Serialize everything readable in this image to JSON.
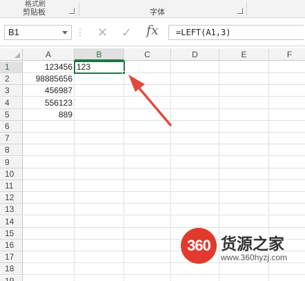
{
  "ribbon": {
    "clipboard_label": "剪贴板",
    "font_label": "字体",
    "top_fragment": "格式刷"
  },
  "formula_bar": {
    "name_box": "B1",
    "cancel_glyph": "✕",
    "enter_glyph": "✓",
    "fx_label": "fx",
    "formula": "=LEFT(A1,3)"
  },
  "sheet": {
    "columns": [
      "A",
      "B",
      "C",
      "D",
      "E",
      "F"
    ],
    "selected_column": "B",
    "rows": [
      "1",
      "2",
      "3",
      "4",
      "5",
      "6",
      "7",
      "8",
      "9",
      "10",
      "11",
      "12",
      "13",
      "14",
      "15",
      "16",
      "17",
      "18",
      "19"
    ],
    "selected_row": "1",
    "column_a": [
      "123456",
      "98885656",
      "456987",
      "556123",
      "889"
    ],
    "b1": "123"
  },
  "watermark": {
    "logo_text": "360",
    "brand_cn": "货源之家",
    "url": "www.360hyzj.com"
  },
  "colors": {
    "accent": "#217346",
    "arrow": "#e04a3a",
    "logo": "#e23a2e"
  }
}
